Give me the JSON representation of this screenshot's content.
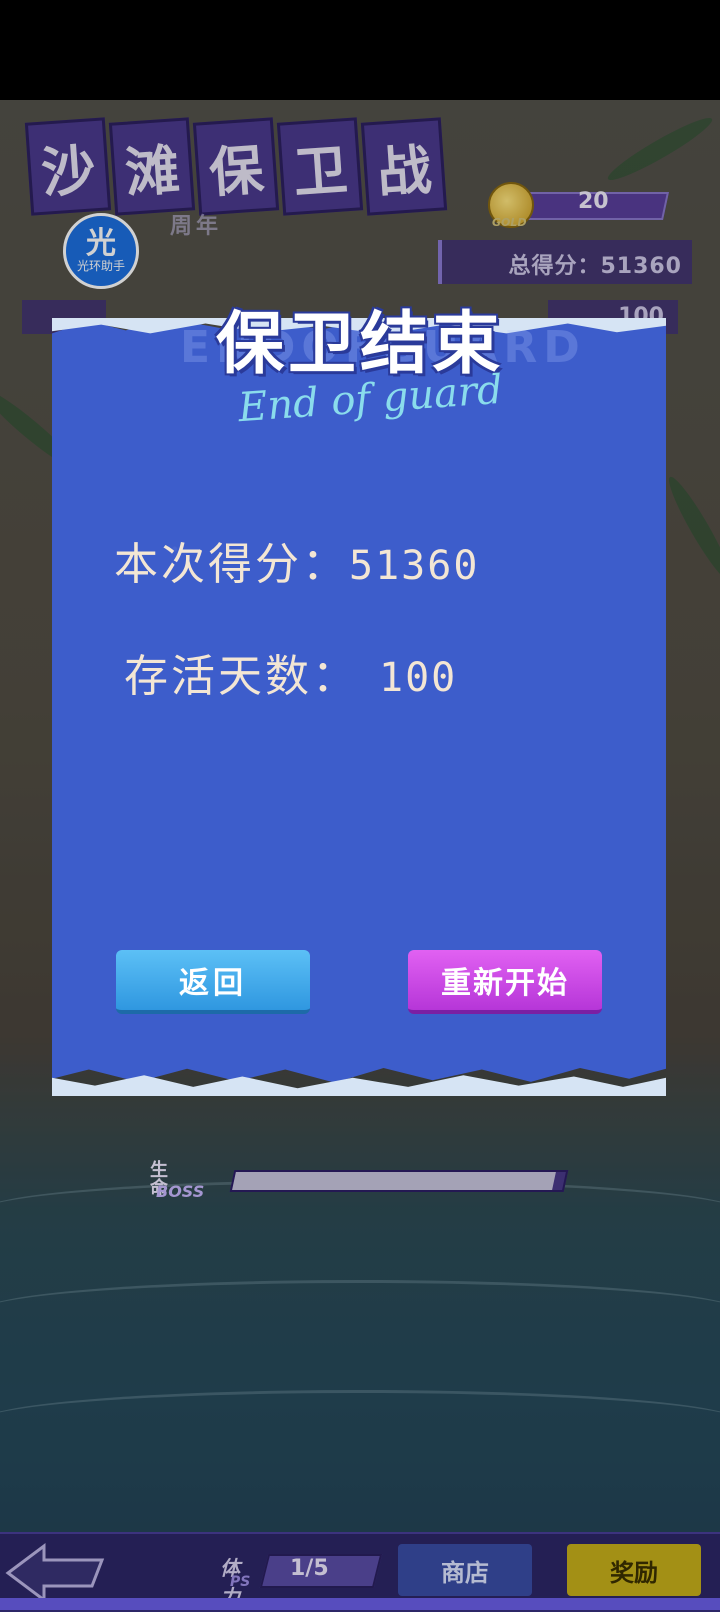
{
  "game": {
    "logo_title": [
      "沙",
      "滩",
      "保",
      "卫",
      "战"
    ],
    "logo_year": "周年",
    "app_badge": {
      "glyph": "光",
      "label": "光环助手"
    },
    "gold": {
      "value": "20",
      "label": "GOLD"
    },
    "total_score": "总得分：51360",
    "days_counter": "100",
    "boss": {
      "label": "生命",
      "sublabel": "BOSS",
      "health_fraction": 0.97
    }
  },
  "modal": {
    "title": "保卫结束",
    "subtitle": "End of guard",
    "ghost_text": "ENDOFGUARD",
    "score_label": "本次得分：",
    "score_value": "51360",
    "days_label": "存活天数：",
    "days_value": "100",
    "back_button": "返回",
    "restart_button": "重新开始"
  },
  "bottom_bar": {
    "stamina_label": "体力",
    "stamina_ps": "PS",
    "stamina_value": "1/5",
    "shop_button": "商店",
    "reward_button": "奖励"
  },
  "colors": {
    "paper": "#3d5dcb",
    "back_button": "#2f97e0",
    "restart_button": "#b636d8",
    "score_text": "#f3e6d4"
  }
}
